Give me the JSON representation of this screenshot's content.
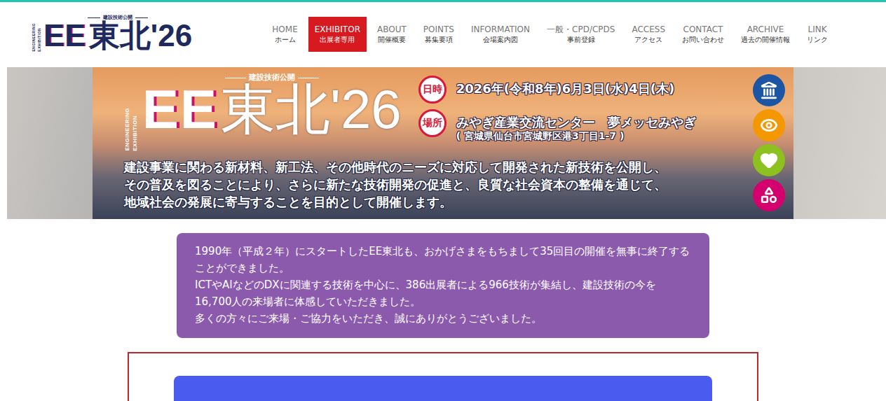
{
  "logo": {
    "mark": "EE",
    "name": "東北'26",
    "tagline": "建設技術公開",
    "vertical": [
      "ENGINEERING",
      "EXHIBITION"
    ]
  },
  "nav": [
    {
      "en": "HOME",
      "ja": "ホーム",
      "selected": false
    },
    {
      "en": "EXHIBITOR",
      "ja": "出展者専用",
      "selected": true
    },
    {
      "en": "ABOUT",
      "ja": "開催概要",
      "selected": false
    },
    {
      "en": "POINTS",
      "ja": "募集要項",
      "selected": false
    },
    {
      "en": "INFORMATION",
      "ja": "会場案内図",
      "selected": false
    },
    {
      "en": "一般・CPD/CPDS",
      "ja": "事前登録",
      "selected": false
    },
    {
      "en": "ACCESS",
      "ja": "アクセス",
      "selected": false
    },
    {
      "en": "CONTACT",
      "ja": "お問い合わせ",
      "selected": false
    },
    {
      "en": "ARCHIVE",
      "ja": "過去の開催情報",
      "selected": false
    },
    {
      "en": "LINK",
      "ja": "リンク",
      "selected": false
    }
  ],
  "banner": {
    "date_label": "日時",
    "date": "2026年(令和8年)6月3日(水)4日(木)",
    "place_label": "場所",
    "venue": "みやぎ産業交流センター　夢メッセみやぎ",
    "address": "( 宮城県仙台市宮城野区港3丁目1-7 )",
    "description": [
      "建設事業に関わる新材料、新工法、その他時代のニーズに対応して開発された新技術を公開し、",
      "その普及を図ることにより、さらに新たな技術開発の促進と、良質な社会資本の整備を通じて、",
      "地域社会の発展に寄与することを目的として開催します。"
    ],
    "badges": [
      {
        "kind": "landmark",
        "color": "#1b55a3"
      },
      {
        "kind": "eye",
        "color": "#f39800"
      },
      {
        "kind": "heart",
        "color": "#8cc11f"
      },
      {
        "kind": "shapes",
        "color": "#d4006e"
      }
    ]
  },
  "notice": [
    "1990年（平成２年）にスタートしたEE東北も、おかげさまをもちまして35回目の開催を無事に終了することができました。",
    "ICTやAIなどのDXに関連する技術を中心に、386出展者による966技術が集結し、建設技術の今を16,700人の来場者に体感していただきました。",
    "多くの方々にご来場・ご協力をいただき、誠にありがとうございました。"
  ]
}
